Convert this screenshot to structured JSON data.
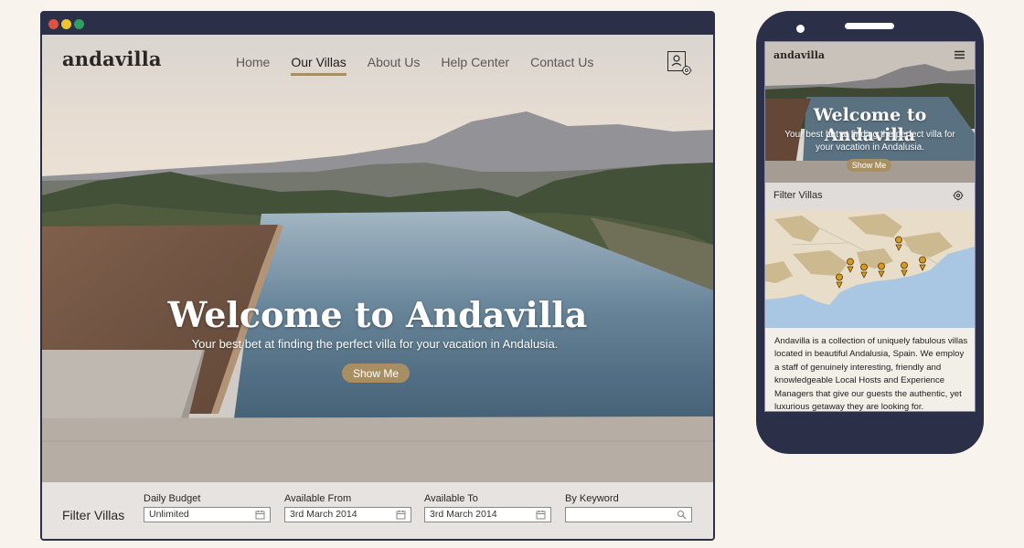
{
  "desktop": {
    "logo": "andavilla",
    "nav": [
      "Home",
      "Our Villas",
      "About Us",
      "Help Center",
      "Contact Us"
    ],
    "active_nav": "Our Villas",
    "hero": {
      "title": "Welcome to Andavilla",
      "subtitle": "Your best bet at finding the perfect villa for your vacation in Andalusia.",
      "button": "Show Me"
    },
    "filter": {
      "title": "Filter Villas",
      "fields": [
        {
          "label": "Daily Budget",
          "value": "Unlimited",
          "icon": "calendar-icon"
        },
        {
          "label": "Available From",
          "value": "3rd March 2014",
          "icon": "calendar-icon"
        },
        {
          "label": "Available To",
          "value": "3rd March 2014",
          "icon": "calendar-icon"
        },
        {
          "label": "By Keyword",
          "value": "",
          "icon": "search-icon"
        }
      ]
    }
  },
  "mobile": {
    "logo": "andavilla",
    "hero": {
      "title": "Welcome to Andavilla",
      "subtitle": "Your best bet at finding the perfect villa for your vacation in Andalusia.",
      "button": "Show Me"
    },
    "filter_label": "Filter Villas",
    "description": "Andavilla is a collection of uniquely fabulous villas located in beautiful Andalusia, Spain. We employ a staff of genuinely interesting, friendly and knowledgeable Local Hosts and Experience Managers that give our guests the authentic, yet luxurious getaway they are looking for."
  },
  "colors": {
    "frame": "#2b2f48",
    "accent": "#a88f63",
    "background": "#f8f3ec",
    "filter_bar": "#e6e3e1"
  }
}
